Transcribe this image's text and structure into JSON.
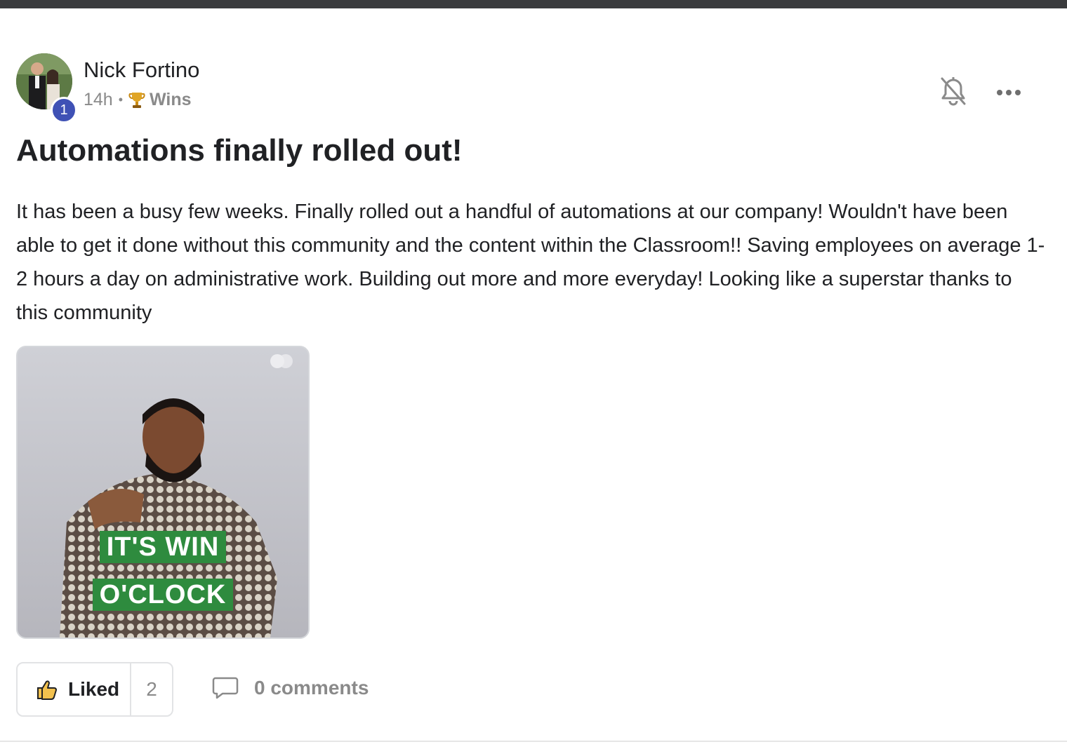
{
  "post": {
    "author": "Nick Fortino",
    "level": "1",
    "time_ago": "14h",
    "separator": "•",
    "category": "Wins",
    "category_icon": "trophy-icon",
    "title": "Automations finally rolled out!",
    "body": "It has been a busy few weeks. Finally rolled out a handful of automations at our company! Wouldn't have been able to get it done without this community and the content within the Classroom!! Saving employees on average 1-2 hours a day on administrative work. Building out more and more everyday! Looking like a superstar thanks to this community",
    "gif": {
      "caption_line1": "IT'S WIN",
      "caption_line2": "O'CLOCK"
    }
  },
  "actions": {
    "like_label": "Liked",
    "like_count": "2",
    "comments_label": "0 comments"
  },
  "header_icons": {
    "bell": "bell-off-icon",
    "more": "more-horizontal-icon"
  },
  "colors": {
    "level_badge": "#3f51b5",
    "muted_text": "#8a8a8a",
    "gif_caption_bg": "#2e8b3e",
    "top_bar": "#3a3b3d"
  }
}
